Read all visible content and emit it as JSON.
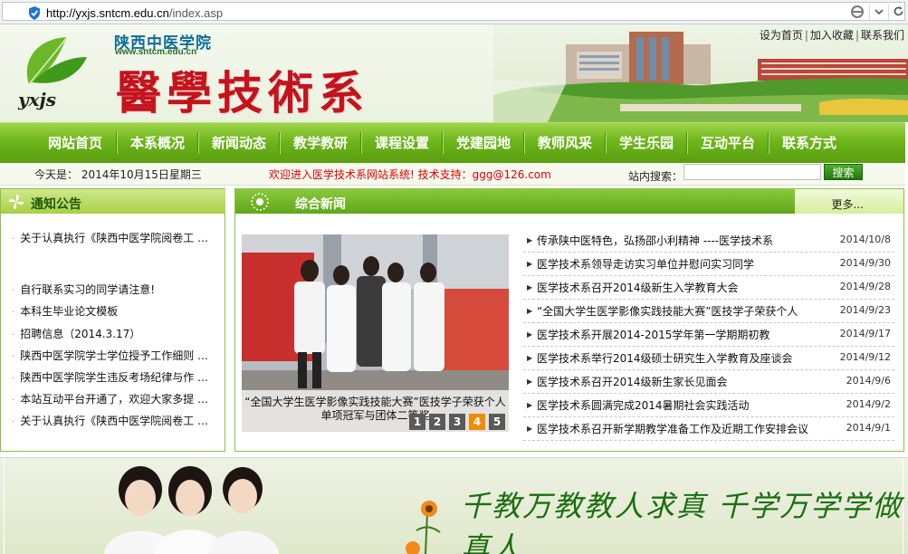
{
  "browser": {
    "url_host": "http://yxjs.sntcm.edu.cn",
    "url_path": "/index.asp"
  },
  "header": {
    "logo_text": "yxjs",
    "school_name": "陕西中医学院",
    "school_url": "www.sntcm.edu.cn",
    "dept_title": "醫學技術系",
    "top_links": [
      "设为首页",
      "加入收藏",
      "联系我们"
    ]
  },
  "nav": {
    "items": [
      "网站首页",
      "本系概况",
      "新闻动态",
      "教学教研",
      "课程设置",
      "党建园地",
      "教师风采",
      "学生乐园",
      "互动平台",
      "联系方式"
    ]
  },
  "infobar": {
    "date": "今天是：  2014年10月15日星期三",
    "welcome": "欢迎进入医学技术系网站系统! 技术支持：ggg@126.com",
    "search_label": "站内搜索：",
    "search_button": "搜索"
  },
  "notice": {
    "title": "通知公告",
    "items": [
      "关于认真执行《陕西中医学院阅卷工 …",
      "自行联系实习的同学请注意!",
      "本科生毕业论文模板",
      "招聘信息（2014.3.17）",
      "陕西中医学院学士学位授予工作细则 …",
      "陕西中医学院学生违反考场纪律与作 …",
      "本站互动平台开通了，欢迎大家多提 …",
      "关于认真执行《陕西中医学院阅卷工 …"
    ]
  },
  "news": {
    "title": "综合新闻",
    "more": "更多...",
    "slide_caption": "“全国大学生医学影像实践技能大赛”医技学子荣获个人单项冠军与团体二等奖",
    "slide_pages": [
      "1",
      "2",
      "3",
      "4",
      "5"
    ],
    "slide_active": 4,
    "items": [
      {
        "title": "传承陕中医特色，弘扬邵小利精神 ----医学技术系",
        "date": "2014/10/8"
      },
      {
        "title": "医学技术系领导走访实习单位并慰问实习同学",
        "date": "2014/9/30"
      },
      {
        "title": "医学技术系召开2014级新生入学教育大会",
        "date": "2014/9/28"
      },
      {
        "title": "“全国大学生医学影像实践技能大赛”医技学子荣获个人",
        "date": "2014/9/23"
      },
      {
        "title": "医学技术系开展2014-2015学年第一学期期初教",
        "date": "2014/9/17"
      },
      {
        "title": "医学技术系举行2014级硕士研究生入学教育及座谈会",
        "date": "2014/9/12"
      },
      {
        "title": "医学技术系召开2014级新生家长见面会",
        "date": "2014/9/6"
      },
      {
        "title": "医学技术系圆满完成2014暑期社会实践活动",
        "date": "2014/9/2"
      },
      {
        "title": "医学技术系召开新学期教学准备工作及近期工作安排会议",
        "date": "2014/9/1"
      }
    ]
  },
  "bottom": {
    "motto": "千教万教教人求真 千学万学学做真人"
  }
}
